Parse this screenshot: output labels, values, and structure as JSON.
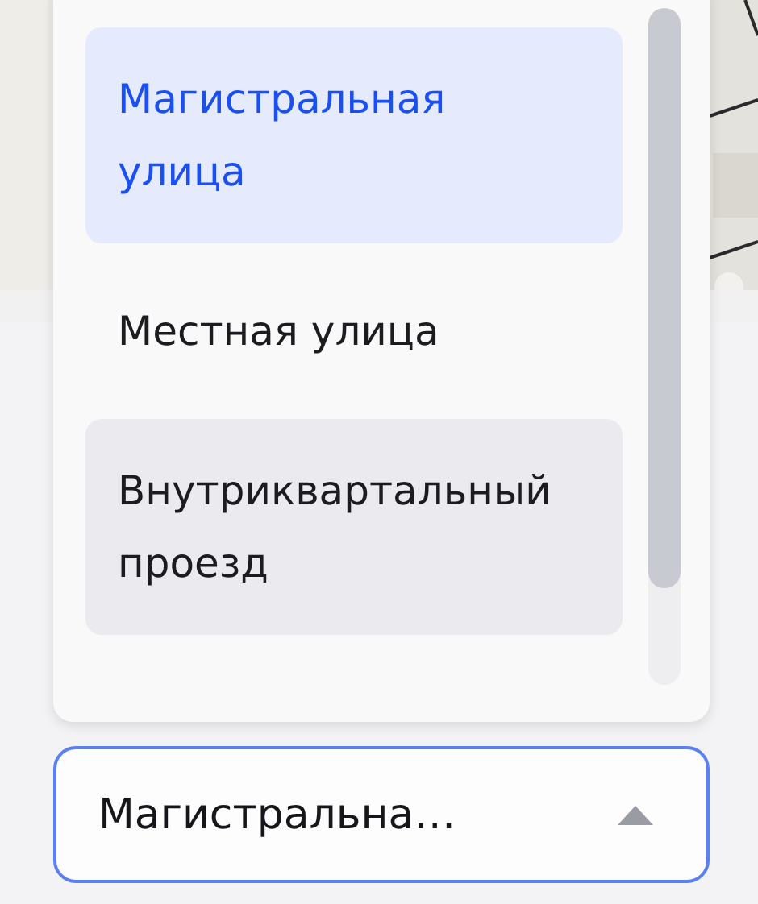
{
  "dropdown": {
    "open": true,
    "options": [
      {
        "label": "Магистральная улица",
        "selected": true,
        "highlighted": false
      },
      {
        "label": "Местная улица",
        "selected": false,
        "highlighted": false
      },
      {
        "label": "Внутриквартальный проезд",
        "selected": false,
        "highlighted": true
      }
    ]
  },
  "field": {
    "value": "Магистральна…",
    "focused": true
  }
}
